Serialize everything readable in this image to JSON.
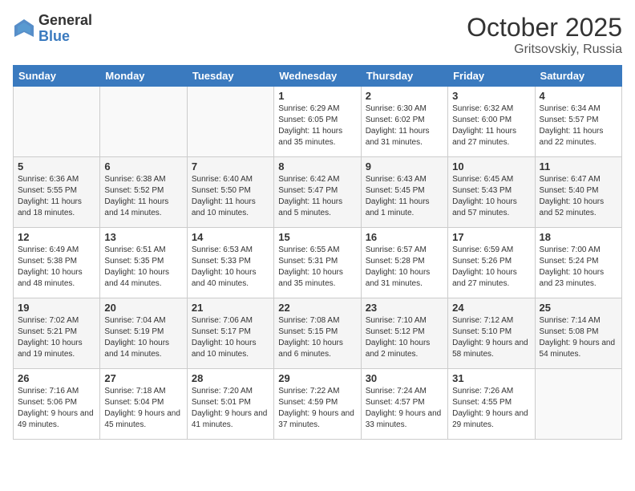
{
  "logo": {
    "general": "General",
    "blue": "Blue"
  },
  "title": "October 2025",
  "location": "Gritsovskiy, Russia",
  "days_of_week": [
    "Sunday",
    "Monday",
    "Tuesday",
    "Wednesday",
    "Thursday",
    "Friday",
    "Saturday"
  ],
  "rows": [
    [
      {
        "day": "",
        "sunrise": "",
        "sunset": "",
        "daylight": ""
      },
      {
        "day": "",
        "sunrise": "",
        "sunset": "",
        "daylight": ""
      },
      {
        "day": "",
        "sunrise": "",
        "sunset": "",
        "daylight": ""
      },
      {
        "day": "1",
        "sunrise": "Sunrise: 6:29 AM",
        "sunset": "Sunset: 6:05 PM",
        "daylight": "Daylight: 11 hours and 35 minutes."
      },
      {
        "day": "2",
        "sunrise": "Sunrise: 6:30 AM",
        "sunset": "Sunset: 6:02 PM",
        "daylight": "Daylight: 11 hours and 31 minutes."
      },
      {
        "day": "3",
        "sunrise": "Sunrise: 6:32 AM",
        "sunset": "Sunset: 6:00 PM",
        "daylight": "Daylight: 11 hours and 27 minutes."
      },
      {
        "day": "4",
        "sunrise": "Sunrise: 6:34 AM",
        "sunset": "Sunset: 5:57 PM",
        "daylight": "Daylight: 11 hours and 22 minutes."
      }
    ],
    [
      {
        "day": "5",
        "sunrise": "Sunrise: 6:36 AM",
        "sunset": "Sunset: 5:55 PM",
        "daylight": "Daylight: 11 hours and 18 minutes."
      },
      {
        "day": "6",
        "sunrise": "Sunrise: 6:38 AM",
        "sunset": "Sunset: 5:52 PM",
        "daylight": "Daylight: 11 hours and 14 minutes."
      },
      {
        "day": "7",
        "sunrise": "Sunrise: 6:40 AM",
        "sunset": "Sunset: 5:50 PM",
        "daylight": "Daylight: 11 hours and 10 minutes."
      },
      {
        "day": "8",
        "sunrise": "Sunrise: 6:42 AM",
        "sunset": "Sunset: 5:47 PM",
        "daylight": "Daylight: 11 hours and 5 minutes."
      },
      {
        "day": "9",
        "sunrise": "Sunrise: 6:43 AM",
        "sunset": "Sunset: 5:45 PM",
        "daylight": "Daylight: 11 hours and 1 minute."
      },
      {
        "day": "10",
        "sunrise": "Sunrise: 6:45 AM",
        "sunset": "Sunset: 5:43 PM",
        "daylight": "Daylight: 10 hours and 57 minutes."
      },
      {
        "day": "11",
        "sunrise": "Sunrise: 6:47 AM",
        "sunset": "Sunset: 5:40 PM",
        "daylight": "Daylight: 10 hours and 52 minutes."
      }
    ],
    [
      {
        "day": "12",
        "sunrise": "Sunrise: 6:49 AM",
        "sunset": "Sunset: 5:38 PM",
        "daylight": "Daylight: 10 hours and 48 minutes."
      },
      {
        "day": "13",
        "sunrise": "Sunrise: 6:51 AM",
        "sunset": "Sunset: 5:35 PM",
        "daylight": "Daylight: 10 hours and 44 minutes."
      },
      {
        "day": "14",
        "sunrise": "Sunrise: 6:53 AM",
        "sunset": "Sunset: 5:33 PM",
        "daylight": "Daylight: 10 hours and 40 minutes."
      },
      {
        "day": "15",
        "sunrise": "Sunrise: 6:55 AM",
        "sunset": "Sunset: 5:31 PM",
        "daylight": "Daylight: 10 hours and 35 minutes."
      },
      {
        "day": "16",
        "sunrise": "Sunrise: 6:57 AM",
        "sunset": "Sunset: 5:28 PM",
        "daylight": "Daylight: 10 hours and 31 minutes."
      },
      {
        "day": "17",
        "sunrise": "Sunrise: 6:59 AM",
        "sunset": "Sunset: 5:26 PM",
        "daylight": "Daylight: 10 hours and 27 minutes."
      },
      {
        "day": "18",
        "sunrise": "Sunrise: 7:00 AM",
        "sunset": "Sunset: 5:24 PM",
        "daylight": "Daylight: 10 hours and 23 minutes."
      }
    ],
    [
      {
        "day": "19",
        "sunrise": "Sunrise: 7:02 AM",
        "sunset": "Sunset: 5:21 PM",
        "daylight": "Daylight: 10 hours and 19 minutes."
      },
      {
        "day": "20",
        "sunrise": "Sunrise: 7:04 AM",
        "sunset": "Sunset: 5:19 PM",
        "daylight": "Daylight: 10 hours and 14 minutes."
      },
      {
        "day": "21",
        "sunrise": "Sunrise: 7:06 AM",
        "sunset": "Sunset: 5:17 PM",
        "daylight": "Daylight: 10 hours and 10 minutes."
      },
      {
        "day": "22",
        "sunrise": "Sunrise: 7:08 AM",
        "sunset": "Sunset: 5:15 PM",
        "daylight": "Daylight: 10 hours and 6 minutes."
      },
      {
        "day": "23",
        "sunrise": "Sunrise: 7:10 AM",
        "sunset": "Sunset: 5:12 PM",
        "daylight": "Daylight: 10 hours and 2 minutes."
      },
      {
        "day": "24",
        "sunrise": "Sunrise: 7:12 AM",
        "sunset": "Sunset: 5:10 PM",
        "daylight": "Daylight: 9 hours and 58 minutes."
      },
      {
        "day": "25",
        "sunrise": "Sunrise: 7:14 AM",
        "sunset": "Sunset: 5:08 PM",
        "daylight": "Daylight: 9 hours and 54 minutes."
      }
    ],
    [
      {
        "day": "26",
        "sunrise": "Sunrise: 7:16 AM",
        "sunset": "Sunset: 5:06 PM",
        "daylight": "Daylight: 9 hours and 49 minutes."
      },
      {
        "day": "27",
        "sunrise": "Sunrise: 7:18 AM",
        "sunset": "Sunset: 5:04 PM",
        "daylight": "Daylight: 9 hours and 45 minutes."
      },
      {
        "day": "28",
        "sunrise": "Sunrise: 7:20 AM",
        "sunset": "Sunset: 5:01 PM",
        "daylight": "Daylight: 9 hours and 41 minutes."
      },
      {
        "day": "29",
        "sunrise": "Sunrise: 7:22 AM",
        "sunset": "Sunset: 4:59 PM",
        "daylight": "Daylight: 9 hours and 37 minutes."
      },
      {
        "day": "30",
        "sunrise": "Sunrise: 7:24 AM",
        "sunset": "Sunset: 4:57 PM",
        "daylight": "Daylight: 9 hours and 33 minutes."
      },
      {
        "day": "31",
        "sunrise": "Sunrise: 7:26 AM",
        "sunset": "Sunset: 4:55 PM",
        "daylight": "Daylight: 9 hours and 29 minutes."
      },
      {
        "day": "",
        "sunrise": "",
        "sunset": "",
        "daylight": ""
      }
    ]
  ]
}
